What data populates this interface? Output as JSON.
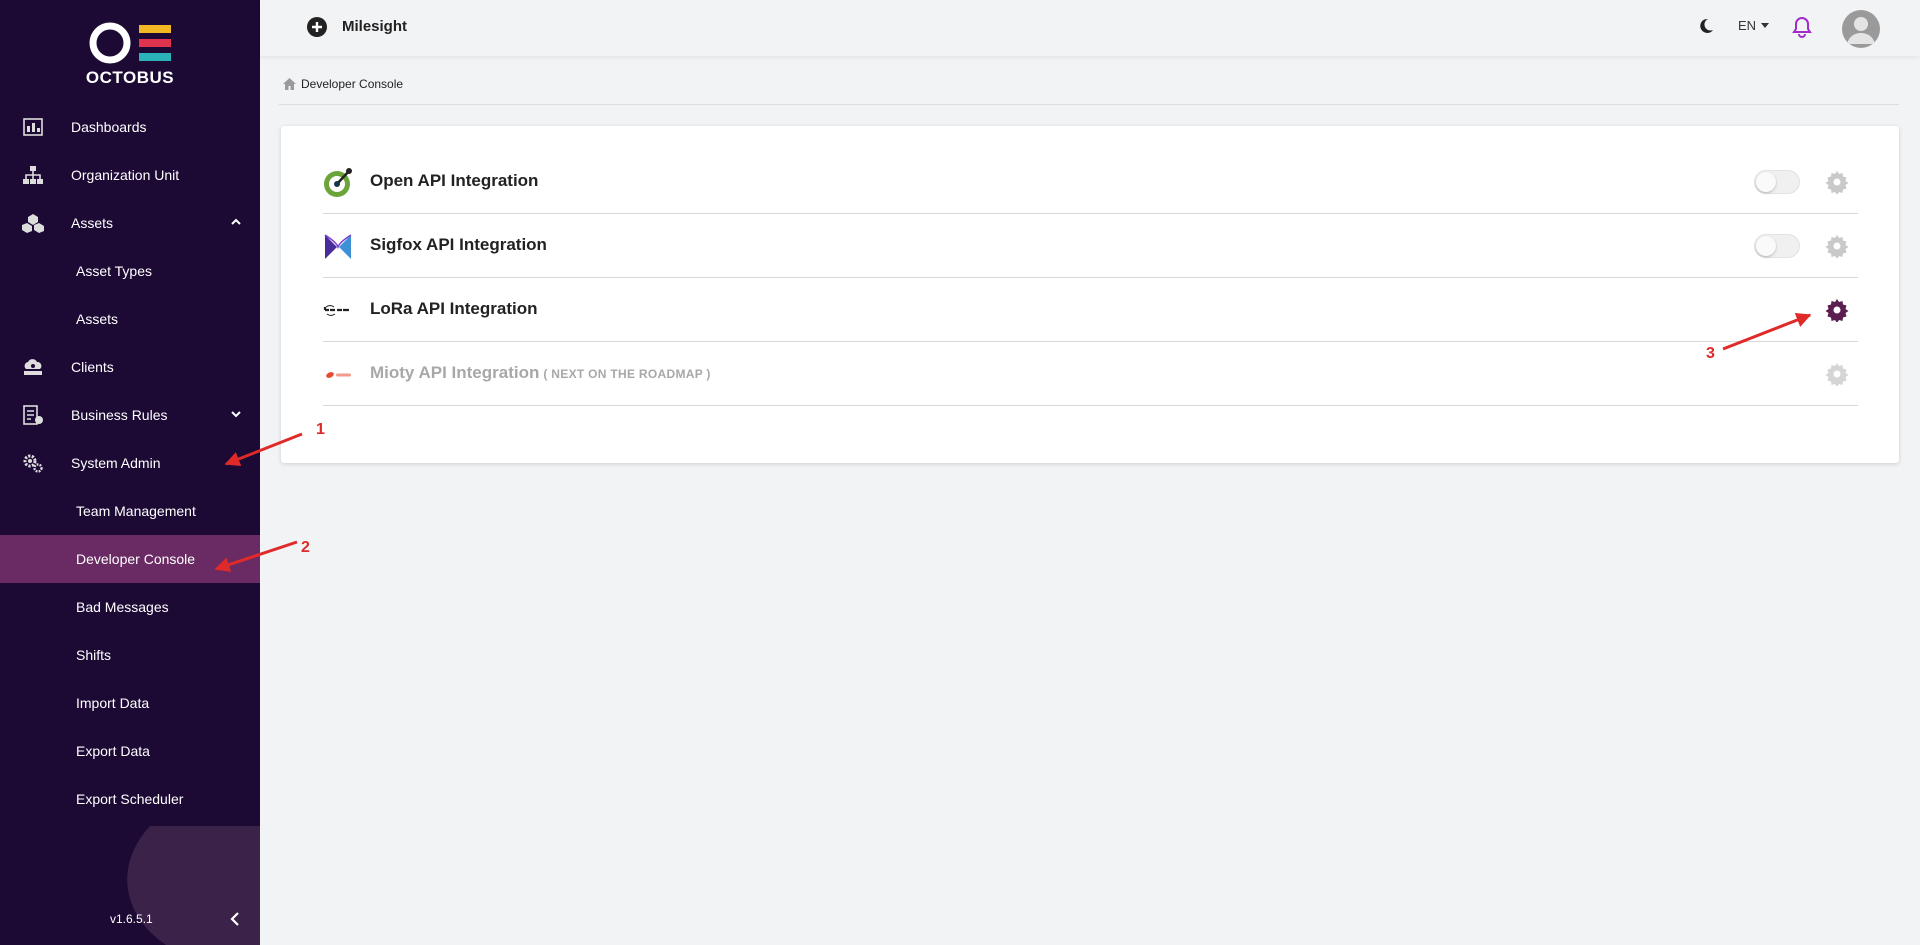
{
  "brand": {
    "name": "OCTOBUS"
  },
  "sidebar": {
    "items": [
      {
        "label": "Dashboards",
        "icon": "dashboard-icon"
      },
      {
        "label": "Organization Unit",
        "icon": "org-tree-icon"
      },
      {
        "label": "Assets",
        "icon": "cubes-icon",
        "expanded": true
      },
      {
        "label": "Asset Types",
        "sub": true
      },
      {
        "label": "Assets",
        "sub": true
      },
      {
        "label": "Clients",
        "icon": "cloud-user-icon"
      },
      {
        "label": "Business Rules",
        "icon": "rules-icon",
        "expanded": false
      },
      {
        "label": "System Admin",
        "icon": "gears-icon",
        "expanded": true
      },
      {
        "label": "Team Management",
        "sub": true
      },
      {
        "label": "Developer Console",
        "sub": true,
        "active": true
      },
      {
        "label": "Bad Messages",
        "sub": true
      },
      {
        "label": "Shifts",
        "sub": true
      },
      {
        "label": "Import Data",
        "sub": true
      },
      {
        "label": "Export Data",
        "sub": true
      },
      {
        "label": "Export Scheduler",
        "sub": true
      }
    ],
    "version": "v1.6.5.1"
  },
  "header": {
    "tenant": "Milesight",
    "language": "EN"
  },
  "breadcrumb": {
    "current": "Developer Console"
  },
  "integrations": [
    {
      "title": "Open API Integration",
      "icon": "openapi-logo-icon",
      "toggle": true,
      "enabled": false
    },
    {
      "title": "Sigfox API Integration",
      "icon": "sigfox-logo-icon",
      "toggle": true,
      "enabled": false
    },
    {
      "title": "LoRa API Integration",
      "icon": "lora-logo-icon",
      "toggle": false
    },
    {
      "title": "Mioty API Integration",
      "note": "( NEXT ON THE ROADMAP )",
      "icon": "mioty-logo-icon",
      "toggle": false,
      "disabled": true
    }
  ],
  "annotations": [
    "1",
    "2",
    "3"
  ],
  "colors": {
    "sidebar_bg": "#1c0934",
    "sidebar_active": "#6a2a63",
    "accent": "#5a1f50",
    "bell": "#a12cc9",
    "annotation": "#e02a2a"
  }
}
